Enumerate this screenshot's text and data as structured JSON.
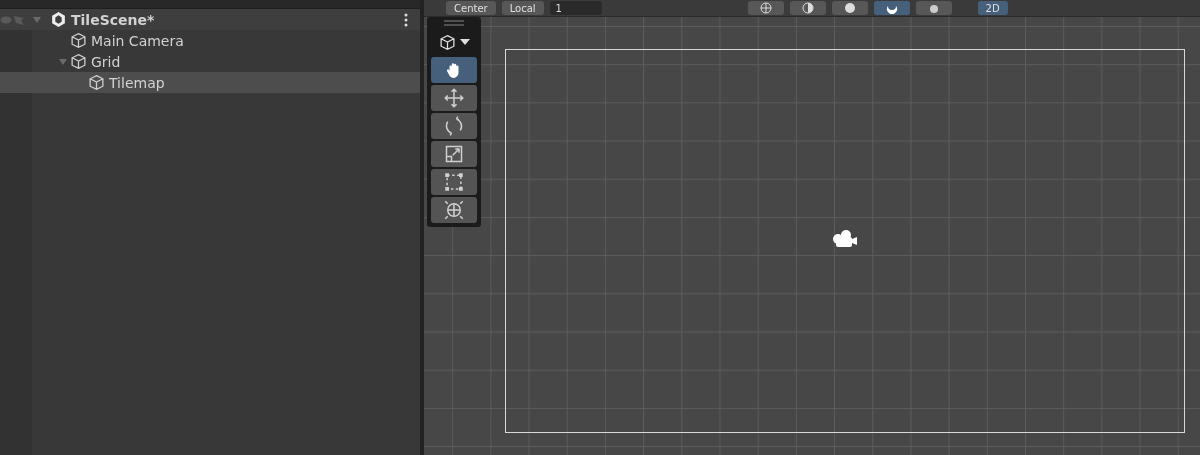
{
  "hierarchy": {
    "scene": {
      "label": "TileScene*",
      "expanded": true,
      "selected": false,
      "children": [
        {
          "label": "Main Camera",
          "selected": false
        },
        {
          "label": "Grid",
          "expanded": true,
          "selected": false,
          "children": [
            {
              "label": "Tilemap",
              "selected": true
            }
          ]
        }
      ]
    }
  },
  "scene_toolbar": {
    "pivot": "Center",
    "space": "Local",
    "snap_value": "1",
    "view_mode": {
      "label": "2D",
      "selected": true
    },
    "shading": [
      {
        "kind": "wire",
        "selected": false
      },
      {
        "kind": "shaded-wire",
        "selected": false
      },
      {
        "kind": "shaded",
        "selected": false
      },
      {
        "kind": "lit",
        "selected": true
      },
      {
        "kind": "gizmo",
        "selected": false
      }
    ]
  },
  "tools": [
    {
      "kind": "hand",
      "selected": true
    },
    {
      "kind": "move",
      "selected": false
    },
    {
      "kind": "rotate",
      "selected": false
    },
    {
      "kind": "scale",
      "selected": false
    },
    {
      "kind": "rect",
      "selected": false
    },
    {
      "kind": "transform",
      "selected": false
    }
  ]
}
